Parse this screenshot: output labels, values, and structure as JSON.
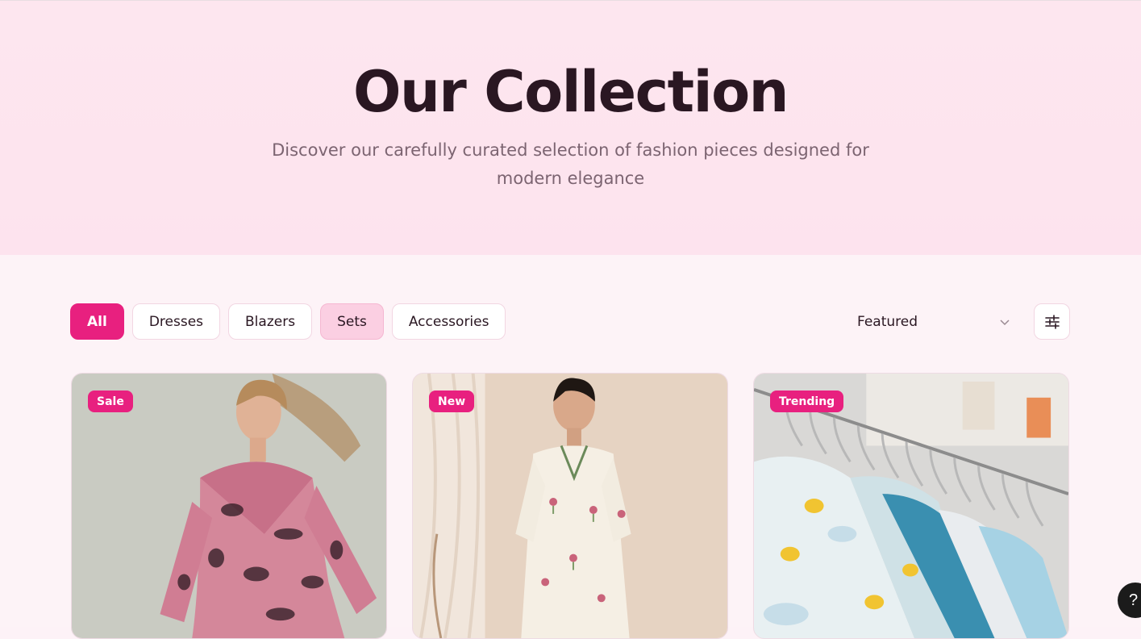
{
  "hero": {
    "title": "Our Collection",
    "subtitle": "Discover our carefully curated selection of fashion pieces designed for modern elegance"
  },
  "filters": [
    {
      "label": "All",
      "state": "active"
    },
    {
      "label": "Dresses",
      "state": "default"
    },
    {
      "label": "Blazers",
      "state": "default"
    },
    {
      "label": "Sets",
      "state": "hover"
    },
    {
      "label": "Accessories",
      "state": "default"
    }
  ],
  "sort": {
    "selected": "Featured"
  },
  "products": [
    {
      "badge": "Sale",
      "image": "woman-pink-floral-wrap-dress"
    },
    {
      "badge": "New",
      "image": "woman-white-floral-kurta-set"
    },
    {
      "badge": "Trending",
      "image": "kids-clothes-on-rack"
    }
  ],
  "help": {
    "label": "?"
  },
  "colors": {
    "accent": "#e8207f",
    "hero_bg": "#fde6ef",
    "page_bg": "#fdf3f7",
    "chip_hover": "#fbcfe2",
    "text": "#2a1722"
  }
}
